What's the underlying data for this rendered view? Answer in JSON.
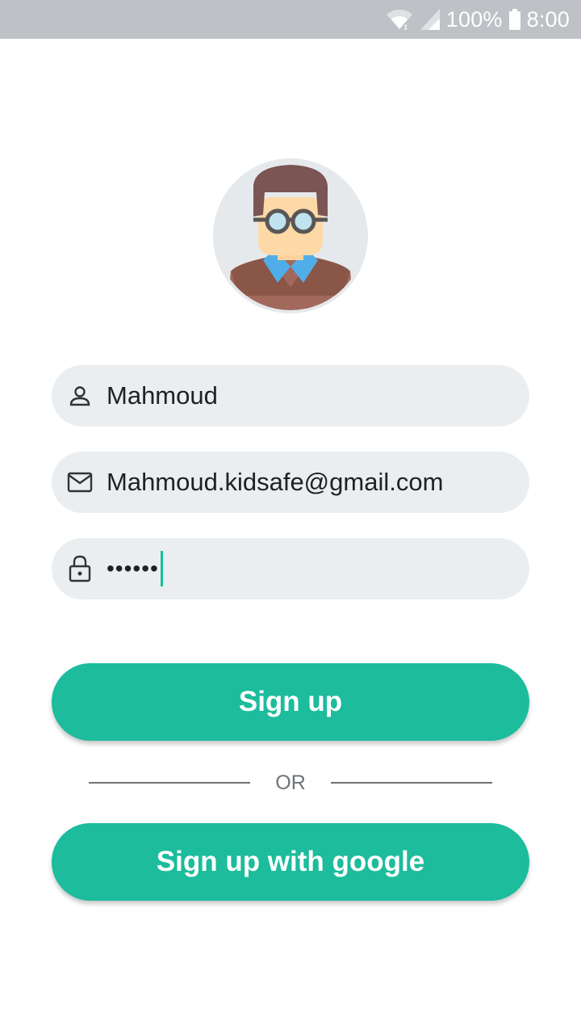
{
  "status_bar": {
    "battery_text": "100%",
    "time": "8:00",
    "icons": [
      "wifi-icon",
      "signal-icon",
      "battery-icon"
    ]
  },
  "avatar": {
    "icon": "avatar-icon"
  },
  "form": {
    "name": {
      "icon": "person-icon",
      "value": "Mahmoud"
    },
    "email": {
      "icon": "mail-icon",
      "value": "Mahmoud.kidsafe@gmail.com"
    },
    "password": {
      "icon": "lock-icon",
      "value_masked": "••••••"
    }
  },
  "buttons": {
    "sign_up": "Sign up",
    "or": "OR",
    "sign_up_google": "Sign up with google"
  },
  "colors": {
    "accent": "#1cbc9c",
    "field_bg": "#ebeef0",
    "status_bar_bg": "#bec2c6"
  }
}
